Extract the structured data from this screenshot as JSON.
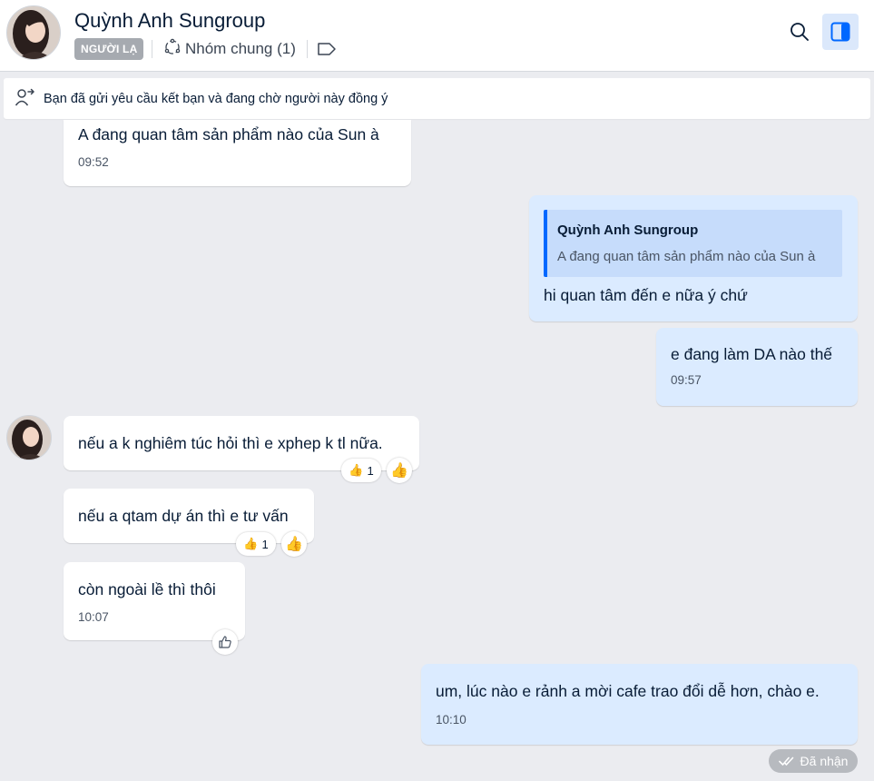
{
  "header": {
    "contact_name": "Quỳnh Anh Sungroup",
    "stranger_badge": "NGƯỜI LẠ",
    "group_label": "Nhóm chung (1)",
    "icons": [
      "avatar",
      "group-icon",
      "tag-icon",
      "search-icon",
      "sidebar-toggle-icon"
    ]
  },
  "request_bar": {
    "text": "Bạn đã gửi yêu cầu kết bạn và đang chờ người này đồng ý",
    "icon": "user-pending-icon"
  },
  "messages": [
    {
      "direction": "in",
      "text": "A đang quan tâm sản phẩm nào của Sun à",
      "time": "09:52"
    },
    {
      "direction": "out",
      "quote_author": "Quỳnh Anh Sungroup",
      "quote_text": "A đang quan tâm sản phẩm nào của Sun à",
      "text": "hi quan tâm đến e nữa ý chứ"
    },
    {
      "direction": "out",
      "text": "e đang làm DA nào thế",
      "time": "09:57"
    },
    {
      "direction": "in",
      "text": "nếu a k nghiêm túc hỏi thì e xphep k tl nữa.",
      "reaction_emoji": "👍",
      "reaction_count": "1"
    },
    {
      "direction": "in",
      "text": "nếu a qtam dự án thì e tư vấn",
      "reaction_emoji": "👍",
      "reaction_count": "1"
    },
    {
      "direction": "in",
      "text": "còn ngoài lề thì thôi",
      "time": "10:07"
    },
    {
      "direction": "out",
      "text": "um, lúc nào e rảnh a mời cafe trao đổi dễ hơn, chào e.",
      "time": "10:10"
    }
  ],
  "status": {
    "label": "Đã nhận",
    "icon": "double-check-icon"
  },
  "colors": {
    "accent": "#0068ff",
    "outgoing_bubble": "#dbebff",
    "chat_background": "#ebecf0"
  }
}
